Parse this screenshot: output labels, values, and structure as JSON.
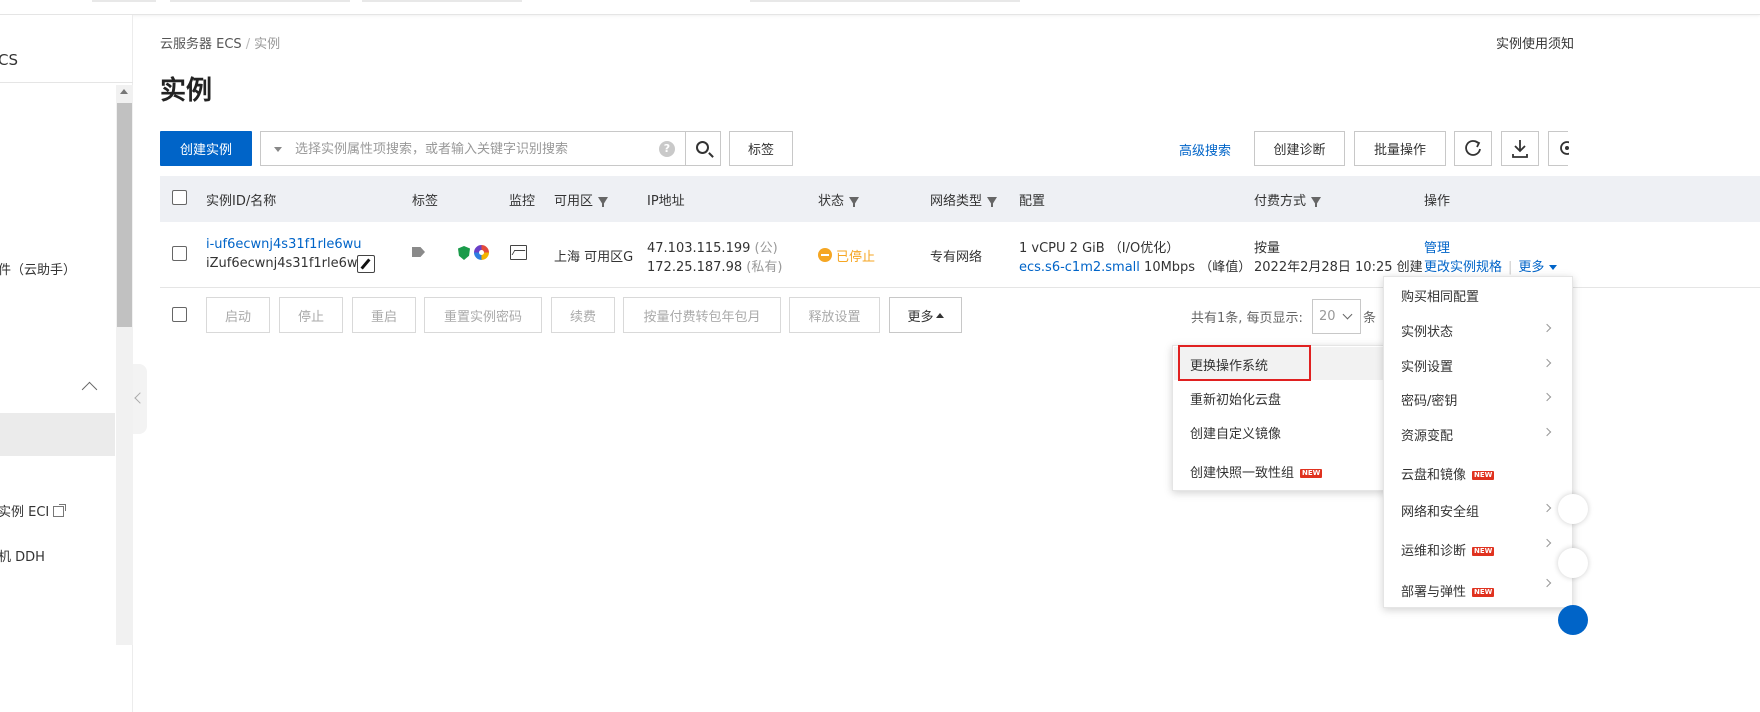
{
  "sidebar": {
    "title": "CS",
    "items": [
      "件（云助手）",
      "实例 ECI",
      "机 DDH"
    ]
  },
  "breadcrumb": {
    "root": "云服务器 ECS",
    "sep": "/",
    "current": "实例"
  },
  "top_right_note": "实例使用须知",
  "page_title": "实例",
  "toolbar": {
    "create_label": "创建实例",
    "search_placeholder": "选择实例属性项搜索，或者输入关键字识别搜索",
    "help_glyph": "?",
    "tag_label": "标签",
    "advanced_search": "高级搜索",
    "diagnose_label": "创建诊断",
    "batch_label": "批量操作"
  },
  "table": {
    "headers": {
      "id_name": "实例ID/名称",
      "tags": "标签",
      "monitor": "监控",
      "zone": "可用区",
      "ip": "IP地址",
      "status": "状态",
      "network": "网络类型",
      "config": "配置",
      "billing": "付费方式",
      "actions": "操作"
    },
    "row": {
      "instance_id": "i-uf6ecwnj4s31f1rle6wu",
      "instance_name": "iZuf6ecwnj4s31f1rle6wuZ",
      "zone": "上海 可用区G",
      "ip_public": "47.103.115.199",
      "ip_public_suffix": "(公)",
      "ip_private": "172.25.187.98",
      "ip_private_suffix": "(私有)",
      "status": "已停止",
      "network": "专有网络",
      "config_line1": "1 vCPU 2 GiB （I/O优化）",
      "config_type": "ecs.s6-c1m2.small",
      "config_bandwidth": "10Mbps （峰值）",
      "billing_type": "按量",
      "billing_created": "2022年2月28日 10:25 创建",
      "action_manage": "管理",
      "action_change_spec": "更改实例规格",
      "action_more": "更多"
    }
  },
  "bottom_toolbar": {
    "buttons": [
      "启动",
      "停止",
      "重启",
      "重置实例密码",
      "续费",
      "按量付费转包年包月",
      "释放设置"
    ],
    "more_label": "更多",
    "pager_text": "共有1条, 每页显示:",
    "page_size": "20",
    "pager_tail": "条"
  },
  "submenu": {
    "items": [
      "更换操作系统",
      "重新初始化云盘",
      "创建自定义镜像",
      "创建快照一致性组"
    ],
    "new_badge": "NEW"
  },
  "more_menu": {
    "items": [
      "购买相同配置",
      "实例状态",
      "实例设置",
      "密码/密钥",
      "资源变配",
      "云盘和镜像",
      "网络和安全组",
      "运维和诊断",
      "部署与弹性"
    ],
    "new_badge": "NEW"
  },
  "colors": {
    "primary": "#0064c8",
    "status_stopped": "#f5a623",
    "new_badge": "#e0321f",
    "highlight": "#e02020"
  }
}
